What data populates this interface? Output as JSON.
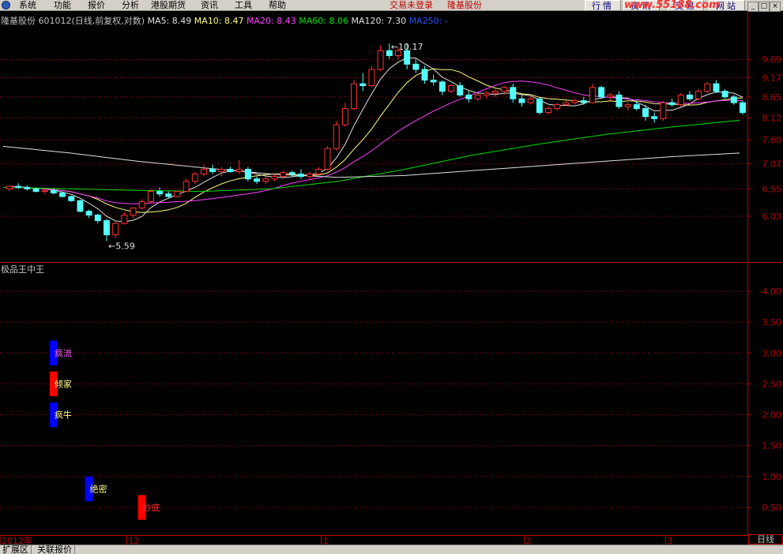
{
  "menubar": {
    "items": [
      "系统",
      "功能",
      "报价",
      "分析",
      "港股期货",
      "资讯",
      "工具",
      "帮助"
    ],
    "login_status": "交易未登录",
    "stock_name": "隆基股份",
    "buttons": [
      "行情",
      "资讯",
      "交易",
      "网站"
    ],
    "ad_text": "www.55188.com"
  },
  "legend": {
    "name": "隆基股份",
    "code": "601012",
    "mode": "(日线,前复权,对数)",
    "items": [
      {
        "label": "MA5: 8.49",
        "color": "#e0e0e0"
      },
      {
        "label": "MA10: 8.47",
        "color": "#ffff80"
      },
      {
        "label": "MA20: 8.43",
        "color": "#ff40ff"
      },
      {
        "label": "MA60: 8.06",
        "color": "#00e000"
      },
      {
        "label": "MA120: 7.30",
        "color": "#e0e0e0"
      },
      {
        "label": "MA250: -",
        "color": "#2050ff"
      }
    ]
  },
  "price_axis": [
    "9.69",
    "9.17",
    "8.65",
    "8.12",
    "7.60",
    "7.07",
    "6.55",
    "6.03"
  ],
  "annotations": {
    "high": "10.17",
    "low": "5.59"
  },
  "indicator": {
    "title": "极品王中王",
    "axis": [
      "4.00",
      "3.50",
      "3.00",
      "2.50",
      "2.00",
      "1.50",
      "1.00",
      "0.50"
    ],
    "signals": [
      "疯流",
      "倾家",
      "疯牛",
      "绝密",
      "抄底"
    ]
  },
  "date_axis": [
    "2012年",
    "12",
    "1",
    "2",
    "3"
  ],
  "period": "日线",
  "bottom_tabs": [
    "扩展区",
    "关联报价"
  ],
  "colors": {
    "up": "#ff3232",
    "down": "#54ffff",
    "grid": "#c00000",
    "axis": "#c00000"
  },
  "chart_data": {
    "type": "candlestick",
    "ohlc": [
      [
        6.55,
        6.62,
        6.5,
        6.6
      ],
      [
        6.6,
        6.66,
        6.55,
        6.58
      ],
      [
        6.58,
        6.62,
        6.52,
        6.55
      ],
      [
        6.55,
        6.58,
        6.48,
        6.5
      ],
      [
        6.5,
        6.55,
        6.45,
        6.52
      ],
      [
        6.52,
        6.56,
        6.44,
        6.47
      ],
      [
        6.47,
        6.5,
        6.38,
        6.4
      ],
      [
        6.4,
        6.42,
        6.3,
        6.32
      ],
      [
        6.32,
        6.34,
        6.1,
        6.12
      ],
      [
        6.12,
        6.15,
        6.0,
        6.05
      ],
      [
        6.05,
        6.08,
        5.9,
        5.95
      ],
      [
        5.95,
        5.98,
        5.59,
        5.7
      ],
      [
        5.7,
        5.95,
        5.65,
        5.9
      ],
      [
        5.9,
        6.1,
        5.88,
        6.05
      ],
      [
        6.05,
        6.2,
        6.0,
        6.18
      ],
      [
        6.18,
        6.35,
        6.15,
        6.3
      ],
      [
        6.3,
        6.55,
        6.28,
        6.5
      ],
      [
        6.5,
        6.58,
        6.4,
        6.45
      ],
      [
        6.45,
        6.5,
        6.36,
        6.4
      ],
      [
        6.4,
        6.52,
        6.38,
        6.5
      ],
      [
        6.5,
        6.75,
        6.48,
        6.7
      ],
      [
        6.7,
        6.9,
        6.65,
        6.85
      ],
      [
        6.85,
        7.05,
        6.8,
        6.95
      ],
      [
        6.95,
        7.05,
        6.85,
        6.9
      ],
      [
        6.9,
        7.0,
        6.8,
        6.95
      ],
      [
        6.95,
        7.0,
        6.88,
        6.9
      ],
      [
        6.9,
        7.15,
        6.85,
        6.95
      ],
      [
        6.95,
        7.0,
        6.7,
        6.75
      ],
      [
        6.75,
        6.8,
        6.65,
        6.7
      ],
      [
        6.7,
        6.8,
        6.65,
        6.75
      ],
      [
        6.75,
        6.85,
        6.7,
        6.8
      ],
      [
        6.8,
        6.92,
        6.75,
        6.88
      ],
      [
        6.88,
        6.92,
        6.8,
        6.85
      ],
      [
        6.85,
        6.95,
        6.75,
        6.8
      ],
      [
        6.8,
        6.9,
        6.72,
        6.85
      ],
      [
        6.85,
        7.0,
        6.82,
        6.95
      ],
      [
        6.95,
        7.45,
        6.92,
        7.4
      ],
      [
        7.4,
        8.05,
        7.35,
        7.95
      ],
      [
        7.95,
        8.5,
        7.9,
        8.35
      ],
      [
        8.35,
        9.1,
        8.3,
        9.0
      ],
      [
        9.0,
        9.3,
        8.8,
        8.95
      ],
      [
        8.95,
        9.5,
        8.9,
        9.4
      ],
      [
        9.4,
        10.1,
        9.35,
        9.95
      ],
      [
        9.95,
        10.17,
        9.7,
        9.8
      ],
      [
        9.8,
        10.05,
        9.7,
        9.95
      ],
      [
        9.95,
        10.17,
        9.4,
        9.55
      ],
      [
        9.55,
        9.7,
        9.3,
        9.4
      ],
      [
        9.4,
        9.5,
        9.0,
        9.1
      ],
      [
        9.1,
        9.25,
        8.95,
        9.05
      ],
      [
        9.05,
        9.1,
        8.7,
        8.8
      ],
      [
        8.8,
        9.0,
        8.75,
        8.95
      ],
      [
        8.95,
        9.05,
        8.65,
        8.7
      ],
      [
        8.7,
        8.8,
        8.5,
        8.6
      ],
      [
        8.6,
        8.75,
        8.55,
        8.7
      ],
      [
        8.7,
        8.8,
        8.6,
        8.75
      ],
      [
        8.75,
        8.85,
        8.65,
        8.8
      ],
      [
        8.8,
        8.95,
        8.7,
        8.9
      ],
      [
        8.9,
        9.0,
        8.5,
        8.6
      ],
      [
        8.6,
        8.7,
        8.4,
        8.5
      ],
      [
        8.5,
        8.65,
        8.45,
        8.6
      ],
      [
        8.6,
        8.65,
        8.2,
        8.25
      ],
      [
        8.25,
        8.4,
        8.2,
        8.35
      ],
      [
        8.35,
        8.5,
        8.3,
        8.45
      ],
      [
        8.45,
        8.55,
        8.4,
        8.5
      ],
      [
        8.5,
        8.6,
        8.45,
        8.55
      ],
      [
        8.55,
        8.65,
        8.45,
        8.5
      ],
      [
        8.5,
        9.0,
        8.48,
        8.9
      ],
      [
        8.9,
        8.95,
        8.6,
        8.65
      ],
      [
        8.65,
        8.75,
        8.55,
        8.7
      ],
      [
        8.7,
        8.8,
        8.35,
        8.4
      ],
      [
        8.4,
        8.5,
        8.3,
        8.45
      ],
      [
        8.45,
        8.55,
        8.3,
        8.35
      ],
      [
        8.35,
        8.45,
        8.05,
        8.15
      ],
      [
        8.15,
        8.25,
        8.0,
        8.1
      ],
      [
        8.1,
        8.55,
        8.05,
        8.5
      ],
      [
        8.5,
        8.6,
        8.4,
        8.45
      ],
      [
        8.45,
        8.75,
        8.4,
        8.7
      ],
      [
        8.7,
        8.8,
        8.55,
        8.6
      ],
      [
        8.6,
        8.85,
        8.55,
        8.8
      ],
      [
        8.8,
        9.05,
        8.75,
        9.0
      ],
      [
        9.0,
        9.1,
        8.75,
        8.8
      ],
      [
        8.8,
        8.85,
        8.6,
        8.65
      ],
      [
        8.65,
        8.7,
        8.45,
        8.5
      ],
      [
        8.5,
        8.55,
        8.2,
        8.25
      ]
    ],
    "ylim": [
      5.59,
      10.17
    ],
    "ma": [
      {
        "name": "MA5",
        "value": 8.49
      },
      {
        "name": "MA10",
        "value": 8.47
      },
      {
        "name": "MA20",
        "value": 8.43
      },
      {
        "name": "MA60",
        "value": 8.06
      },
      {
        "name": "MA120",
        "value": 7.3
      }
    ],
    "signals": [
      {
        "label": "疯流",
        "bar": 5,
        "value": 3.0,
        "color": "#0000ff"
      },
      {
        "label": "倾家",
        "bar": 5,
        "value": 2.5,
        "color": "#ff0000"
      },
      {
        "label": "疯牛",
        "bar": 5,
        "value": 2.0,
        "color": "#0000ff"
      },
      {
        "label": "绝密",
        "bar": 9,
        "value": 0.8,
        "color": "#0000ff"
      },
      {
        "label": "抄底",
        "bar": 15,
        "value": 0.5,
        "color": "#ff0000"
      }
    ]
  }
}
